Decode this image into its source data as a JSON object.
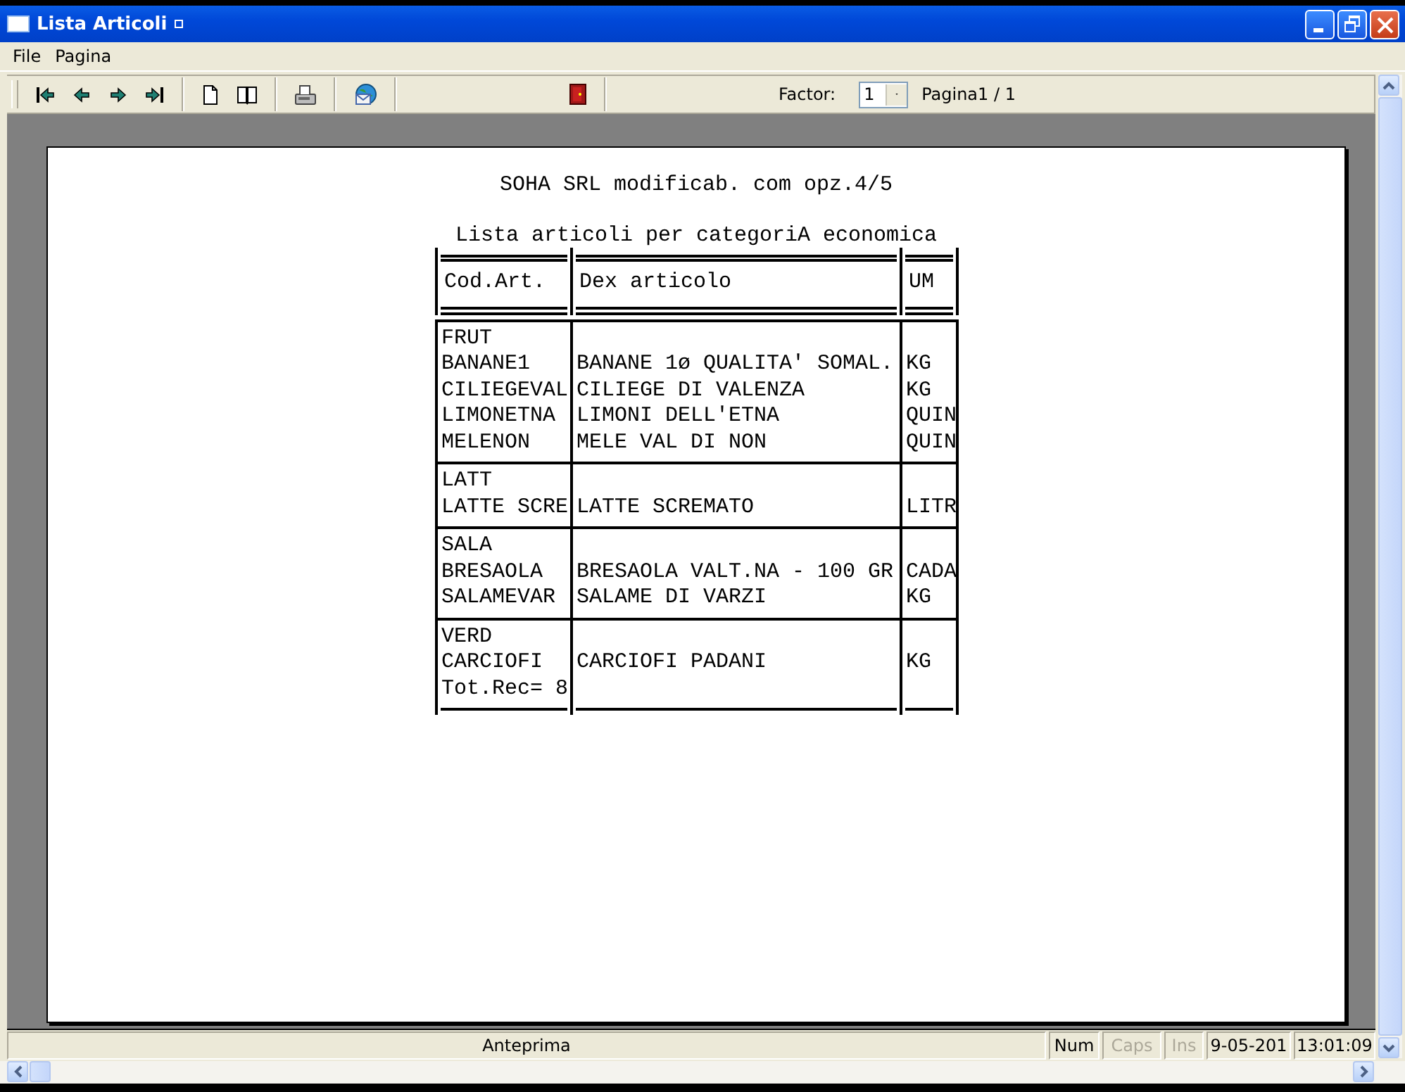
{
  "window": {
    "title": "Lista Articoli"
  },
  "menu": [
    {
      "label": "File"
    },
    {
      "label": "Pagina"
    }
  ],
  "toolbar": {
    "factor_label": "Factor:",
    "factor_value": "1",
    "page_info": "Pagina1 / 1"
  },
  "report": {
    "title": "SOHA SRL modificab. com opz.4/5",
    "subtitle": "Lista articoli per categoriA economica",
    "columns": [
      "Cod.Art.",
      "Dex articolo",
      "UM"
    ],
    "groups": [
      {
        "category": "FRUT",
        "items": [
          {
            "code": "BANANE1",
            "description": "BANANE 1ø QUALITA' SOMAL.",
            "um": "KG"
          },
          {
            "code": "CILIEGEVAL",
            "description": "CILIEGE DI VALENZA",
            "um": "KG"
          },
          {
            "code": "LIMONETNA",
            "description": "LIMONI DELL'ETNA",
            "um": "QUIN"
          },
          {
            "code": "MELENON",
            "description": "MELE VAL DI NON",
            "um": "QUIN"
          }
        ]
      },
      {
        "category": "LATT",
        "items": [
          {
            "code": "LATTE SCRE",
            "description": "LATTE SCREMATO",
            "um": "LITR"
          }
        ]
      },
      {
        "category": "SALA",
        "items": [
          {
            "code": "BRESAOLA",
            "description": "BRESAOLA VALT.NA - 100 GR",
            "um": "CADA"
          },
          {
            "code": "SALAMEVAR",
            "description": "SALAME DI VARZI",
            "um": "KG"
          }
        ]
      },
      {
        "category": "VERD",
        "items": [
          {
            "code": "CARCIOFI",
            "description": "CARCIOFI PADANI",
            "um": "KG"
          }
        ]
      }
    ],
    "total": "Tot.Rec= 8"
  },
  "status_bar": {
    "message": "Anteprima",
    "indicators": [
      {
        "label": "Num",
        "disabled": false
      },
      {
        "label": "Caps",
        "disabled": true
      },
      {
        "label": "Ins",
        "disabled": true
      }
    ],
    "date": "9-05-201",
    "time": "13:01:09"
  }
}
